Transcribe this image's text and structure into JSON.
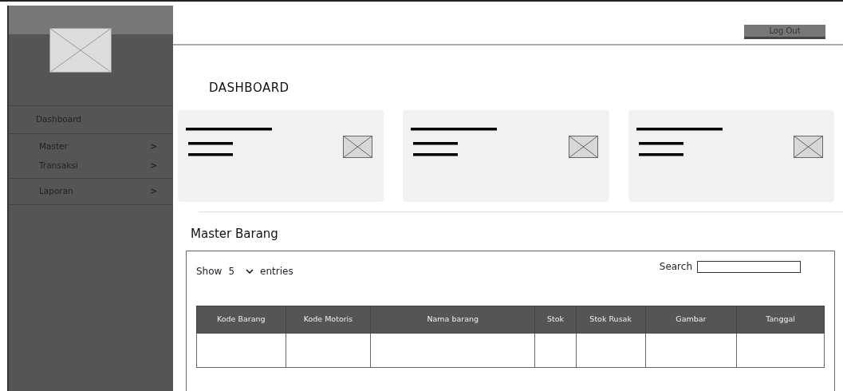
{
  "header": {
    "logout_button": "Log Out"
  },
  "sidebar": {
    "groups": [
      [
        {
          "label": "Dashboard"
        }
      ],
      [
        {
          "label": "Master",
          "arrow": ">"
        },
        {
          "label": "Transaksi",
          "arrow": ">"
        }
      ],
      [
        {
          "label": "Laporan",
          "arrow": ">"
        }
      ]
    ]
  },
  "page_title": "DASHBOARD",
  "cards": [
    {
      "kind": "placeholder"
    },
    {
      "kind": "placeholder"
    },
    {
      "kind": "placeholder"
    }
  ],
  "section_title": "Master Barang",
  "table_controls": {
    "show_label": "Show",
    "page_size": "5",
    "entries_label": "entries",
    "search_label": "Search"
  },
  "table": {
    "columns": [
      "Kode Barang",
      "Kode Motoris",
      "Nama barang",
      "Stok",
      "Stok Rusak",
      "Gambar",
      "Tanggal"
    ]
  }
}
